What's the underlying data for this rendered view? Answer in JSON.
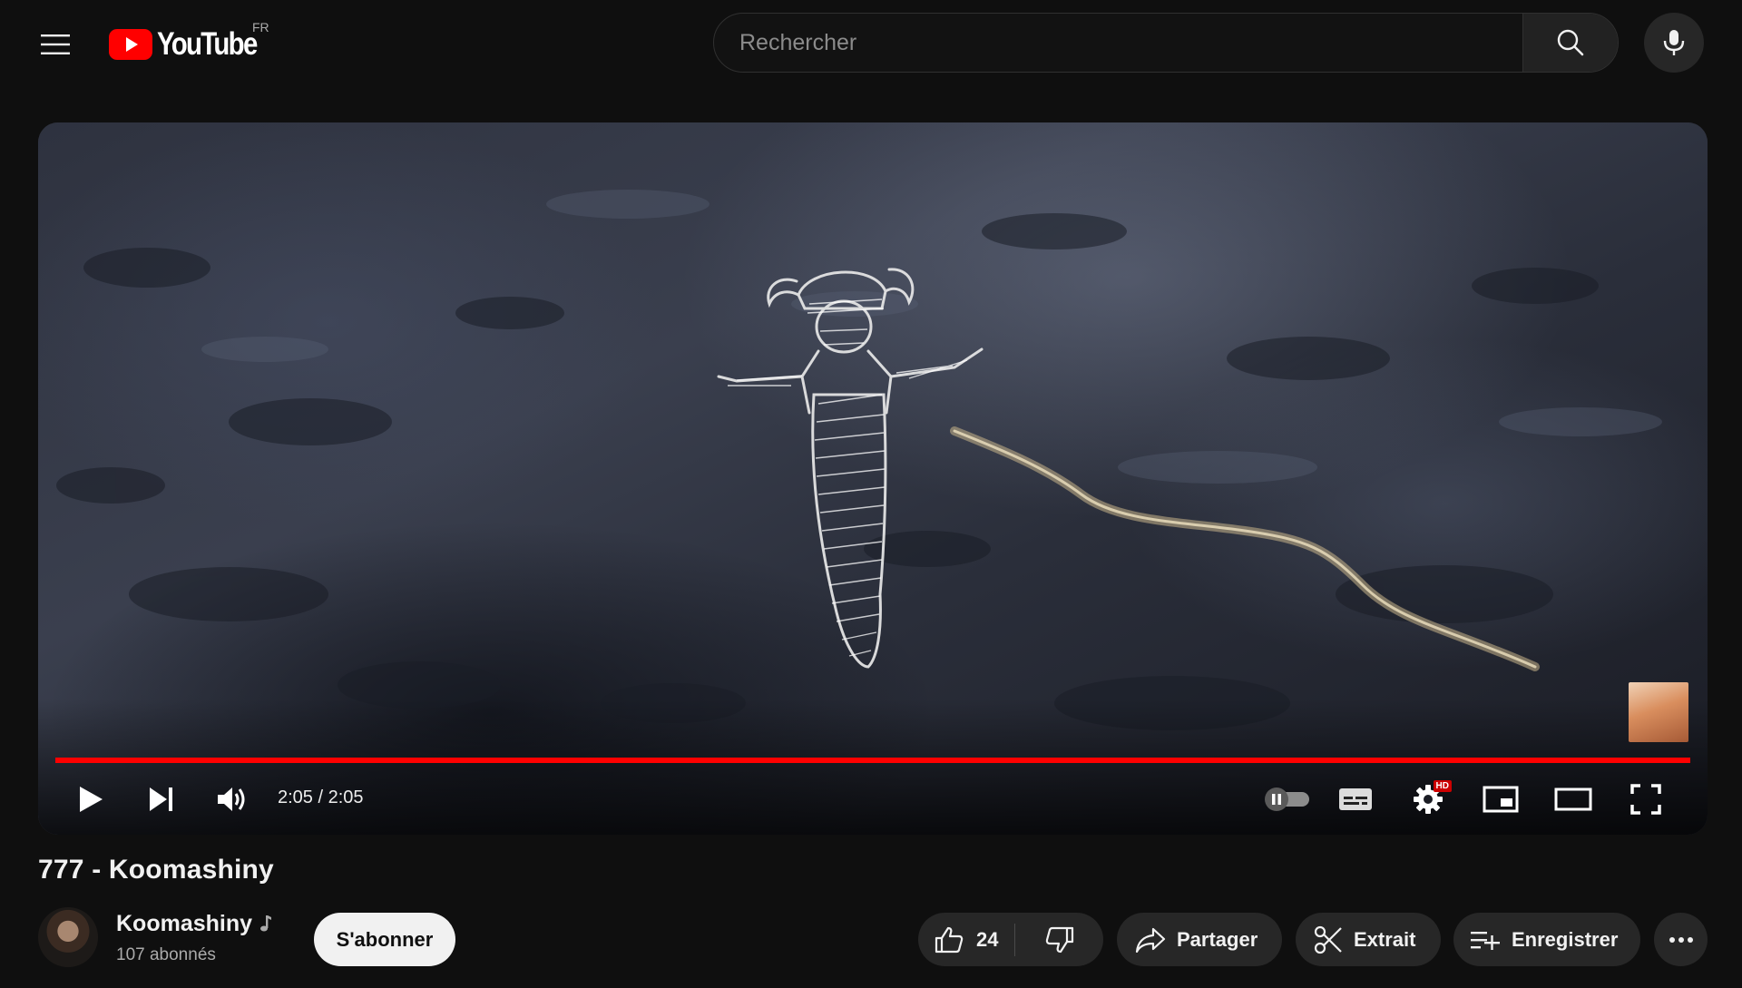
{
  "masthead": {
    "logo_text": "YouTube",
    "country_code": "FR",
    "search_placeholder": "Rechercher",
    "icons": [
      "menu-icon",
      "youtube-logo-icon",
      "search-icon",
      "microphone-icon"
    ]
  },
  "player": {
    "time_display": "2:05 / 2:05",
    "progress_fraction": 1.0,
    "hd_badge": "HD",
    "accent_color": "#ff0000",
    "controls": [
      "play-icon",
      "next-icon",
      "volume-icon",
      "autoplay-toggle-icon",
      "subtitles-icon",
      "settings-icon",
      "miniplayer-icon",
      "theater-mode-icon",
      "fullscreen-icon"
    ]
  },
  "video": {
    "title": "777 - Koomashiny"
  },
  "channel": {
    "name": "Koomashiny",
    "subscribers": "107 abonnés",
    "subscribe_label": "S'abonner"
  },
  "actions": {
    "like_count": "24",
    "share_label": "Partager",
    "clip_label": "Extrait",
    "save_label": "Enregistrer"
  }
}
